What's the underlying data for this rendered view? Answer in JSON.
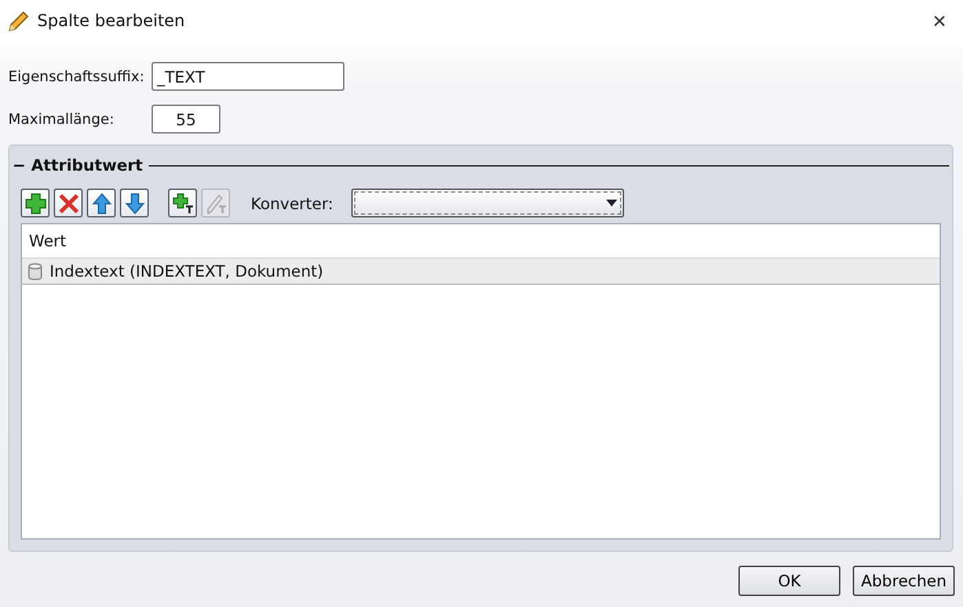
{
  "window": {
    "title": "Spalte bearbeiten",
    "close": "✕"
  },
  "fields": [
    {
      "label": "Eigenschaftssuffix:",
      "value": "_TEXT",
      "kind": "wide"
    },
    {
      "label": "Maximallänge:",
      "value": "55",
      "kind": "number"
    }
  ],
  "group": {
    "title": "Attributwert",
    "collapse": "−",
    "toolbar": [
      {
        "kind": "add",
        "disabled": false
      },
      {
        "kind": "delete",
        "disabled": false
      },
      {
        "kind": "up",
        "disabled": false
      },
      {
        "kind": "down",
        "disabled": false
      },
      {
        "kind": "add-text",
        "disabled": false
      },
      {
        "kind": "edit-text",
        "disabled": true
      }
    ],
    "converter": {
      "label": "Konverter:"
    },
    "list": {
      "column": "Wert",
      "rows": [
        {
          "text": "Indextext (INDEXTEXT, Dokument)",
          "selected": true
        }
      ]
    }
  },
  "buttons": [
    "OK",
    "Abbrechen"
  ]
}
